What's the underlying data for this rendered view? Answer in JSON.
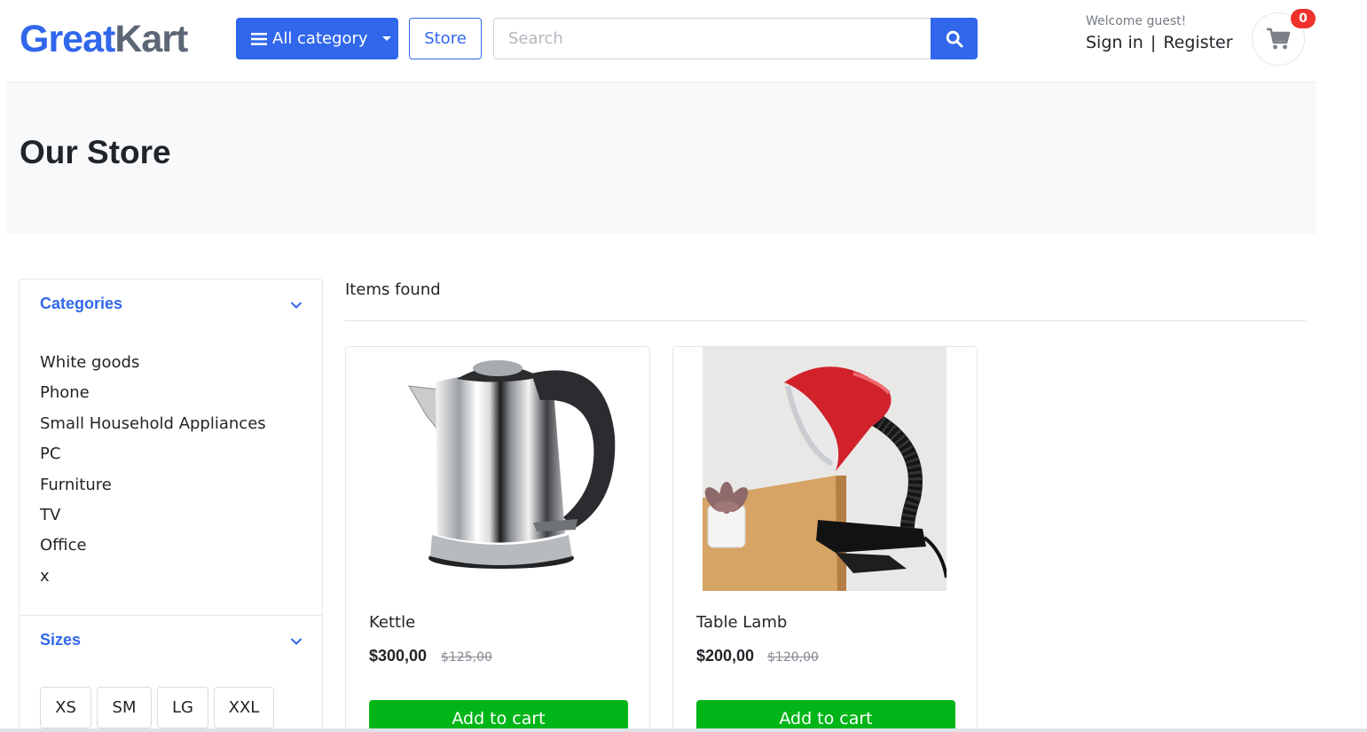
{
  "header": {
    "logo": {
      "part1": "Great",
      "part2": "Kart"
    },
    "all_category_label": "All category",
    "store_label": "Store",
    "search": {
      "placeholder": "Search",
      "value": ""
    },
    "welcome": "Welcome guest!",
    "sign_in": "Sign in",
    "separator": "|",
    "register": "Register",
    "cart_count": "0"
  },
  "banner": {
    "title": "Our Store"
  },
  "sidebar": {
    "categories_title": "Categories",
    "categories": [
      "White goods",
      "Phone",
      "Small Household Appliances",
      "PC",
      "Furniture",
      "TV",
      "Office",
      "x"
    ],
    "sizes_title": "Sizes",
    "sizes": [
      "XS",
      "SM",
      "LG",
      "XXL"
    ]
  },
  "main": {
    "items_found": "Items found",
    "products": [
      {
        "name": "Kettle",
        "price": "$300,00",
        "old_price": "$125,00",
        "button": "Add to cart"
      },
      {
        "name": "Table Lamb",
        "price": "$200,00",
        "old_price": "$120,00",
        "button": "Add to cart"
      }
    ]
  },
  "colors": {
    "primary": "#3167eb",
    "success": "#00b517",
    "badge": "#f0312c",
    "banner_bg": "#f8f9fa"
  }
}
